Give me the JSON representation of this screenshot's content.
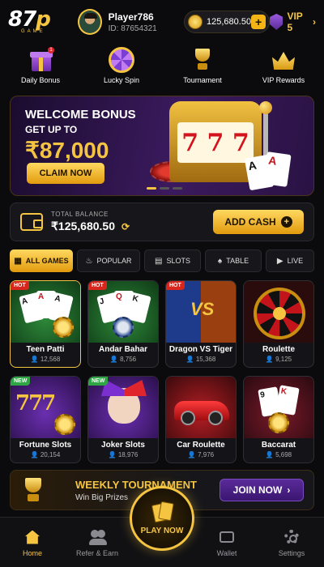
{
  "header": {
    "logo_main": "87",
    "logo_accent": "p",
    "logo_sub": "GAME",
    "player_name": "Player786",
    "player_id": "ID: 87654321",
    "coin_balance": "125,680.50",
    "plus_label": "+",
    "vip_label": "VIP 5",
    "vip_chevron": "›"
  },
  "quick_nav": [
    {
      "label": "Daily Bonus",
      "icon": "gift-icon",
      "badge": "1"
    },
    {
      "label": "Lucky Spin",
      "icon": "wheel-icon"
    },
    {
      "label": "Tournament",
      "icon": "trophy-icon"
    },
    {
      "label": "VIP Rewards",
      "icon": "crown-icon"
    }
  ],
  "banner": {
    "title": "WELCOME BONUS",
    "subtitle": "GET UP TO",
    "amount": "₹87,000",
    "cta": "CLAIM NOW",
    "slot_symbols": [
      "7",
      "7",
      "7"
    ],
    "card_ranks": [
      "A",
      "A"
    ],
    "active_slide": 1,
    "slide_count": 3
  },
  "balance": {
    "label": "TOTAL BALANCE",
    "value": "₹125,680.50",
    "refresh_icon": "⟳",
    "cta": "ADD CASH",
    "cta_icon": "+"
  },
  "categories": [
    {
      "label": "ALL GAMES",
      "icon": "▦",
      "active": true
    },
    {
      "label": "POPULAR",
      "icon": "♨",
      "active": false
    },
    {
      "label": "SLOTS",
      "icon": "▤",
      "active": false
    },
    {
      "label": "TABLE",
      "icon": "♠",
      "active": false
    },
    {
      "label": "LIVE",
      "icon": "▶",
      "active": false
    }
  ],
  "games": [
    {
      "name": "Teen Patti",
      "players": "12,568",
      "tag": "HOT"
    },
    {
      "name": "Andar Bahar",
      "players": "8,756",
      "tag": "HOT"
    },
    {
      "name": "Dragon VS Tiger",
      "players": "15,368",
      "tag": "HOT"
    },
    {
      "name": "Roulette",
      "players": "9,125",
      "tag": ""
    },
    {
      "name": "Fortune Slots",
      "players": "20,154",
      "tag": "NEW"
    },
    {
      "name": "Joker Slots",
      "players": "18,976",
      "tag": "NEW"
    },
    {
      "name": "Car Roulette",
      "players": "7,976",
      "tag": ""
    },
    {
      "name": "Baccarat",
      "players": "5,698",
      "tag": ""
    }
  ],
  "game_art": {
    "vs_text": "VS",
    "sevens_text": "777",
    "card_ranks_teen": [
      "A",
      "A",
      "A"
    ],
    "card_ranks_andar": [
      "J",
      "Q",
      "K"
    ],
    "card_ranks_baccarat": [
      "9",
      "K"
    ]
  },
  "tournament": {
    "title": "WEEKLY TOURNAMENT",
    "subtitle": "Win Big Prizes",
    "cta": "JOIN NOW",
    "cta_icon": "›"
  },
  "bottom_nav": {
    "home": "Home",
    "refer": "Refer & Earn",
    "play": "PLAY NOW",
    "wallet": "Wallet",
    "settings": "Settings"
  },
  "colors": {
    "accent": "#f5c542",
    "background": "#0b0b0d",
    "hot": "#d9261c",
    "new": "#2fa544",
    "join": "#5a2a9a"
  }
}
